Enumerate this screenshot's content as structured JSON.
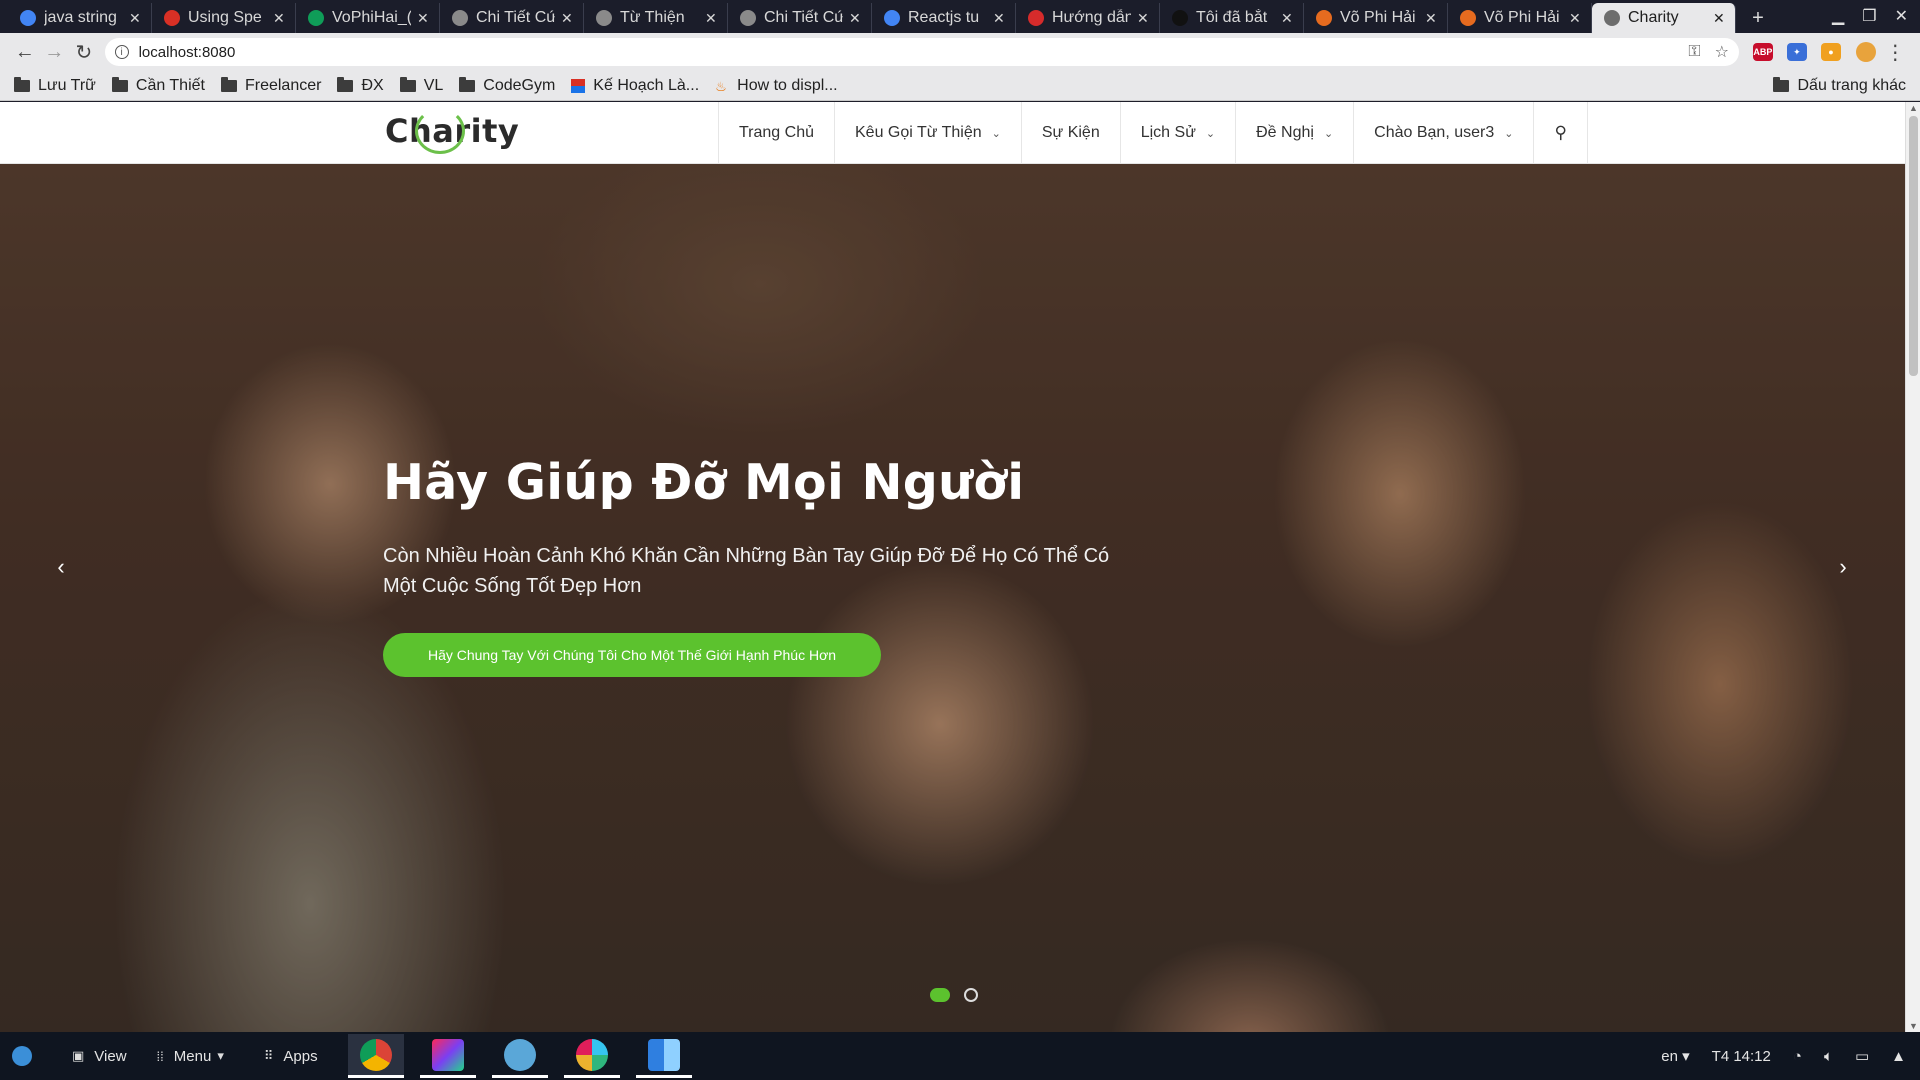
{
  "browser": {
    "tabs": [
      {
        "title": "java string",
        "favicon": "google-icon",
        "color": "#4285f4"
      },
      {
        "title": "Using Spe",
        "favicon": "red-flag-icon",
        "color": "#d93025"
      },
      {
        "title": "VoPhiHai_(",
        "favicon": "sheets-icon",
        "color": "#0f9d58"
      },
      {
        "title": "Chi Tiết Cứ",
        "favicon": "globe-icon",
        "color": "#8a8a8a"
      },
      {
        "title": "Từ Thiện",
        "favicon": "globe-icon",
        "color": "#8a8a8a"
      },
      {
        "title": "Chi Tiết Cứ",
        "favicon": "globe-icon",
        "color": "#8a8a8a"
      },
      {
        "title": "Reactjs tu",
        "favicon": "google-icon",
        "color": "#4285f4"
      },
      {
        "title": "Hướng dẫn",
        "favicon": "red-badge-icon",
        "color": "#d62b2b"
      },
      {
        "title": "Tôi đã bắt",
        "favicon": "medium-icon",
        "color": "#111111"
      },
      {
        "title": "Võ Phi Hải",
        "favicon": "fox-icon",
        "color": "#e66b1f"
      },
      {
        "title": "Võ Phi Hải",
        "favicon": "fox-icon",
        "color": "#e66b1f"
      },
      {
        "title": "Charity",
        "favicon": "globe-icon",
        "color": "#6d6d6d",
        "active": true
      }
    ],
    "new_tab_label": "+",
    "url": "localhost:8080",
    "bookmarks": [
      {
        "label": "Lưu Trữ",
        "icon": "folder-icon"
      },
      {
        "label": "Cần Thiết",
        "icon": "folder-icon"
      },
      {
        "label": "Freelancer",
        "icon": "folder-icon"
      },
      {
        "label": "ĐX",
        "icon": "folder-icon"
      },
      {
        "label": "VL",
        "icon": "folder-icon"
      },
      {
        "label": "CodeGym",
        "icon": "folder-icon"
      },
      {
        "label": "Kế Hoạch Là...",
        "icon": "flag-icon"
      },
      {
        "label": "How to displ...",
        "icon": "java-icon"
      }
    ],
    "other_bookmarks": "Dấu trang khác",
    "extensions": [
      {
        "label": "ABP",
        "color": "#c70d2c"
      },
      {
        "label": "✦",
        "color": "#3a6fd8"
      },
      {
        "label": "●",
        "color": "#f0a020"
      }
    ]
  },
  "site": {
    "logo": "Charity",
    "menu": [
      {
        "label": "Trang Chủ",
        "dropdown": false
      },
      {
        "label": "Kêu Gọi Từ Thiện",
        "dropdown": true
      },
      {
        "label": "Sự Kiện",
        "dropdown": false
      },
      {
        "label": "Lịch Sử",
        "dropdown": true
      },
      {
        "label": "Đề Nghị",
        "dropdown": true
      },
      {
        "label": "Chào Bạn, user3",
        "dropdown": true
      }
    ],
    "hero": {
      "title": "Hãy Giúp Đỡ Mọi Người",
      "subtitle": "Còn Nhiều Hoàn Cảnh Khó Khăn Cần Những Bàn Tay Giúp Đỡ Để Họ Có Thể Có Một Cuộc Sống Tốt Đẹp Hơn",
      "cta": "Hãy Chung Tay Với Chúng Tôi Cho Một Thế Giới Hạnh Phúc Hơn",
      "slides": 2,
      "active_slide": 1
    },
    "accent": "#5cc22e"
  },
  "taskbar": {
    "view_label": "View",
    "menu_label": "Menu",
    "apps_label": "Apps",
    "apps": [
      "chrome-icon",
      "intellij-icon",
      "dolphin-icon",
      "slack-icon",
      "finder-icon"
    ],
    "lang": "en",
    "clock": "T4 14:12"
  }
}
